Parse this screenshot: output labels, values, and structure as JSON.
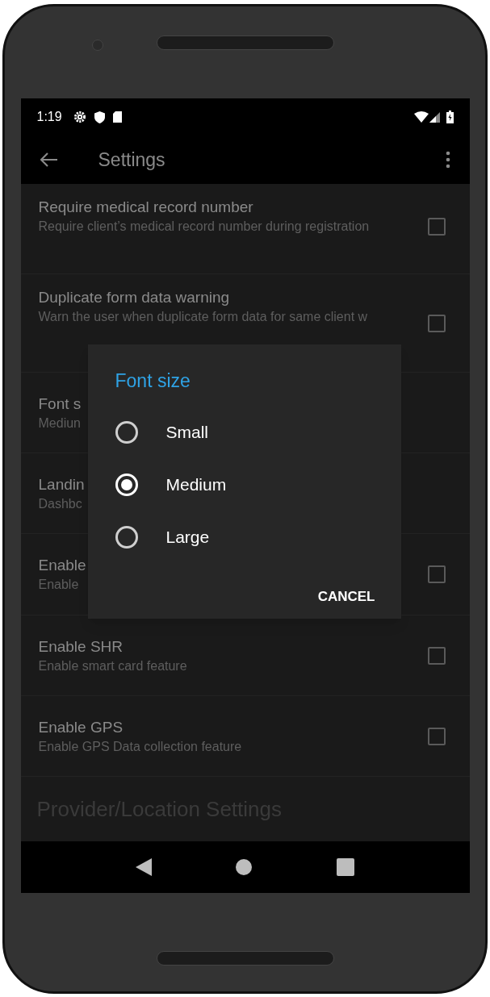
{
  "status_bar": {
    "time": "1:19"
  },
  "toolbar": {
    "title": "Settings"
  },
  "preferences": [
    {
      "kind": "checkbox",
      "title": "Require medical record number",
      "summary": "Require client’s medical record number during registration",
      "checked": false
    },
    {
      "kind": "checkbox",
      "title": "Duplicate form data warning",
      "summary": "Warn the user when duplicate form data for same client w",
      "checked": false
    },
    {
      "kind": "list",
      "title": "Font s",
      "summary": "Mediun"
    },
    {
      "kind": "list",
      "title": "Landin",
      "summary": "Dashbc"
    },
    {
      "kind": "checkbox",
      "title": "Enable",
      "summary": "Enable",
      "checked": false
    },
    {
      "kind": "checkbox",
      "title": "Enable SHR",
      "summary": "Enable smart card feature",
      "checked": false
    },
    {
      "kind": "checkbox",
      "title": "Enable GPS",
      "summary": "Enable GPS Data collection feature",
      "checked": false
    }
  ],
  "category": "Provider/Location Settings",
  "dialog": {
    "title": "Font size",
    "options": [
      {
        "label": "Small",
        "selected": false
      },
      {
        "label": "Medium",
        "selected": true
      },
      {
        "label": "Large",
        "selected": false
      }
    ],
    "button": "CANCEL"
  }
}
